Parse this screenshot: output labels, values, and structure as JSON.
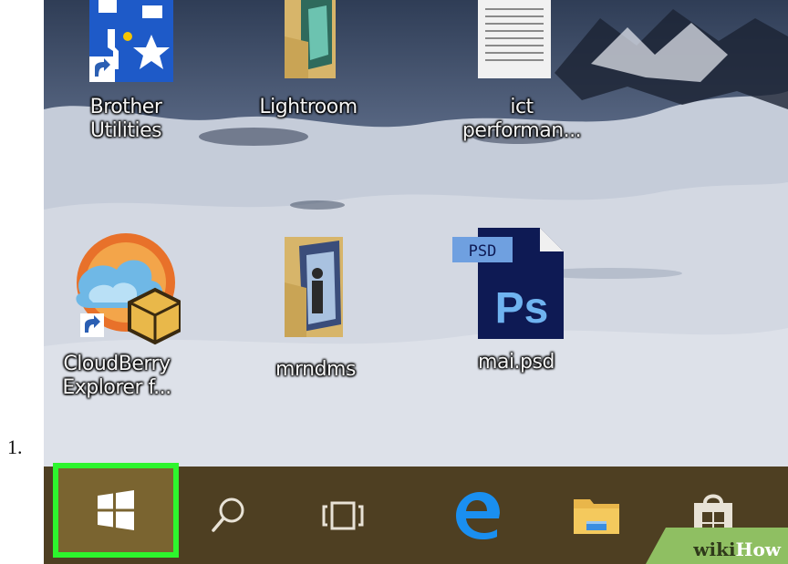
{
  "step": {
    "number": "1."
  },
  "desktop": {
    "icons": [
      {
        "id": "brother",
        "label_line1": "Brother",
        "label_line2": "Utilities",
        "icon": "toolbox-shortcut-icon"
      },
      {
        "id": "lightroom",
        "label_line1": "Lightroom",
        "label_line2": "",
        "icon": "photo-folder-icon"
      },
      {
        "id": "ict",
        "label_line1": "ict",
        "label_line2": "performan...",
        "icon": "document-icon"
      },
      {
        "id": "cloudberry",
        "label_line1": "CloudBerry",
        "label_line2": "Explorer f...",
        "icon": "cloudberry-shortcut-icon"
      },
      {
        "id": "mrndms",
        "label_line1": "mrndms",
        "label_line2": "",
        "icon": "photo-folder-icon"
      },
      {
        "id": "psd",
        "label_line1": "mai.psd",
        "label_line2": "",
        "icon": "psd-file-icon",
        "badge": "PSD",
        "glyph": "Ps"
      }
    ]
  },
  "taskbar": {
    "items": [
      {
        "name": "start-button",
        "icon": "windows-logo-icon",
        "highlighted": true
      },
      {
        "name": "search-button",
        "icon": "search-icon"
      },
      {
        "name": "task-view-button",
        "icon": "task-view-icon"
      },
      {
        "name": "edge-button",
        "icon": "edge-icon"
      },
      {
        "name": "file-explorer-button",
        "icon": "folder-icon"
      },
      {
        "name": "store-button",
        "icon": "store-bag-icon"
      }
    ],
    "highlight_color": "#2df52d",
    "bar_color": "#4e3f22"
  },
  "watermark": {
    "part1": "wiki",
    "part2": "How"
  }
}
